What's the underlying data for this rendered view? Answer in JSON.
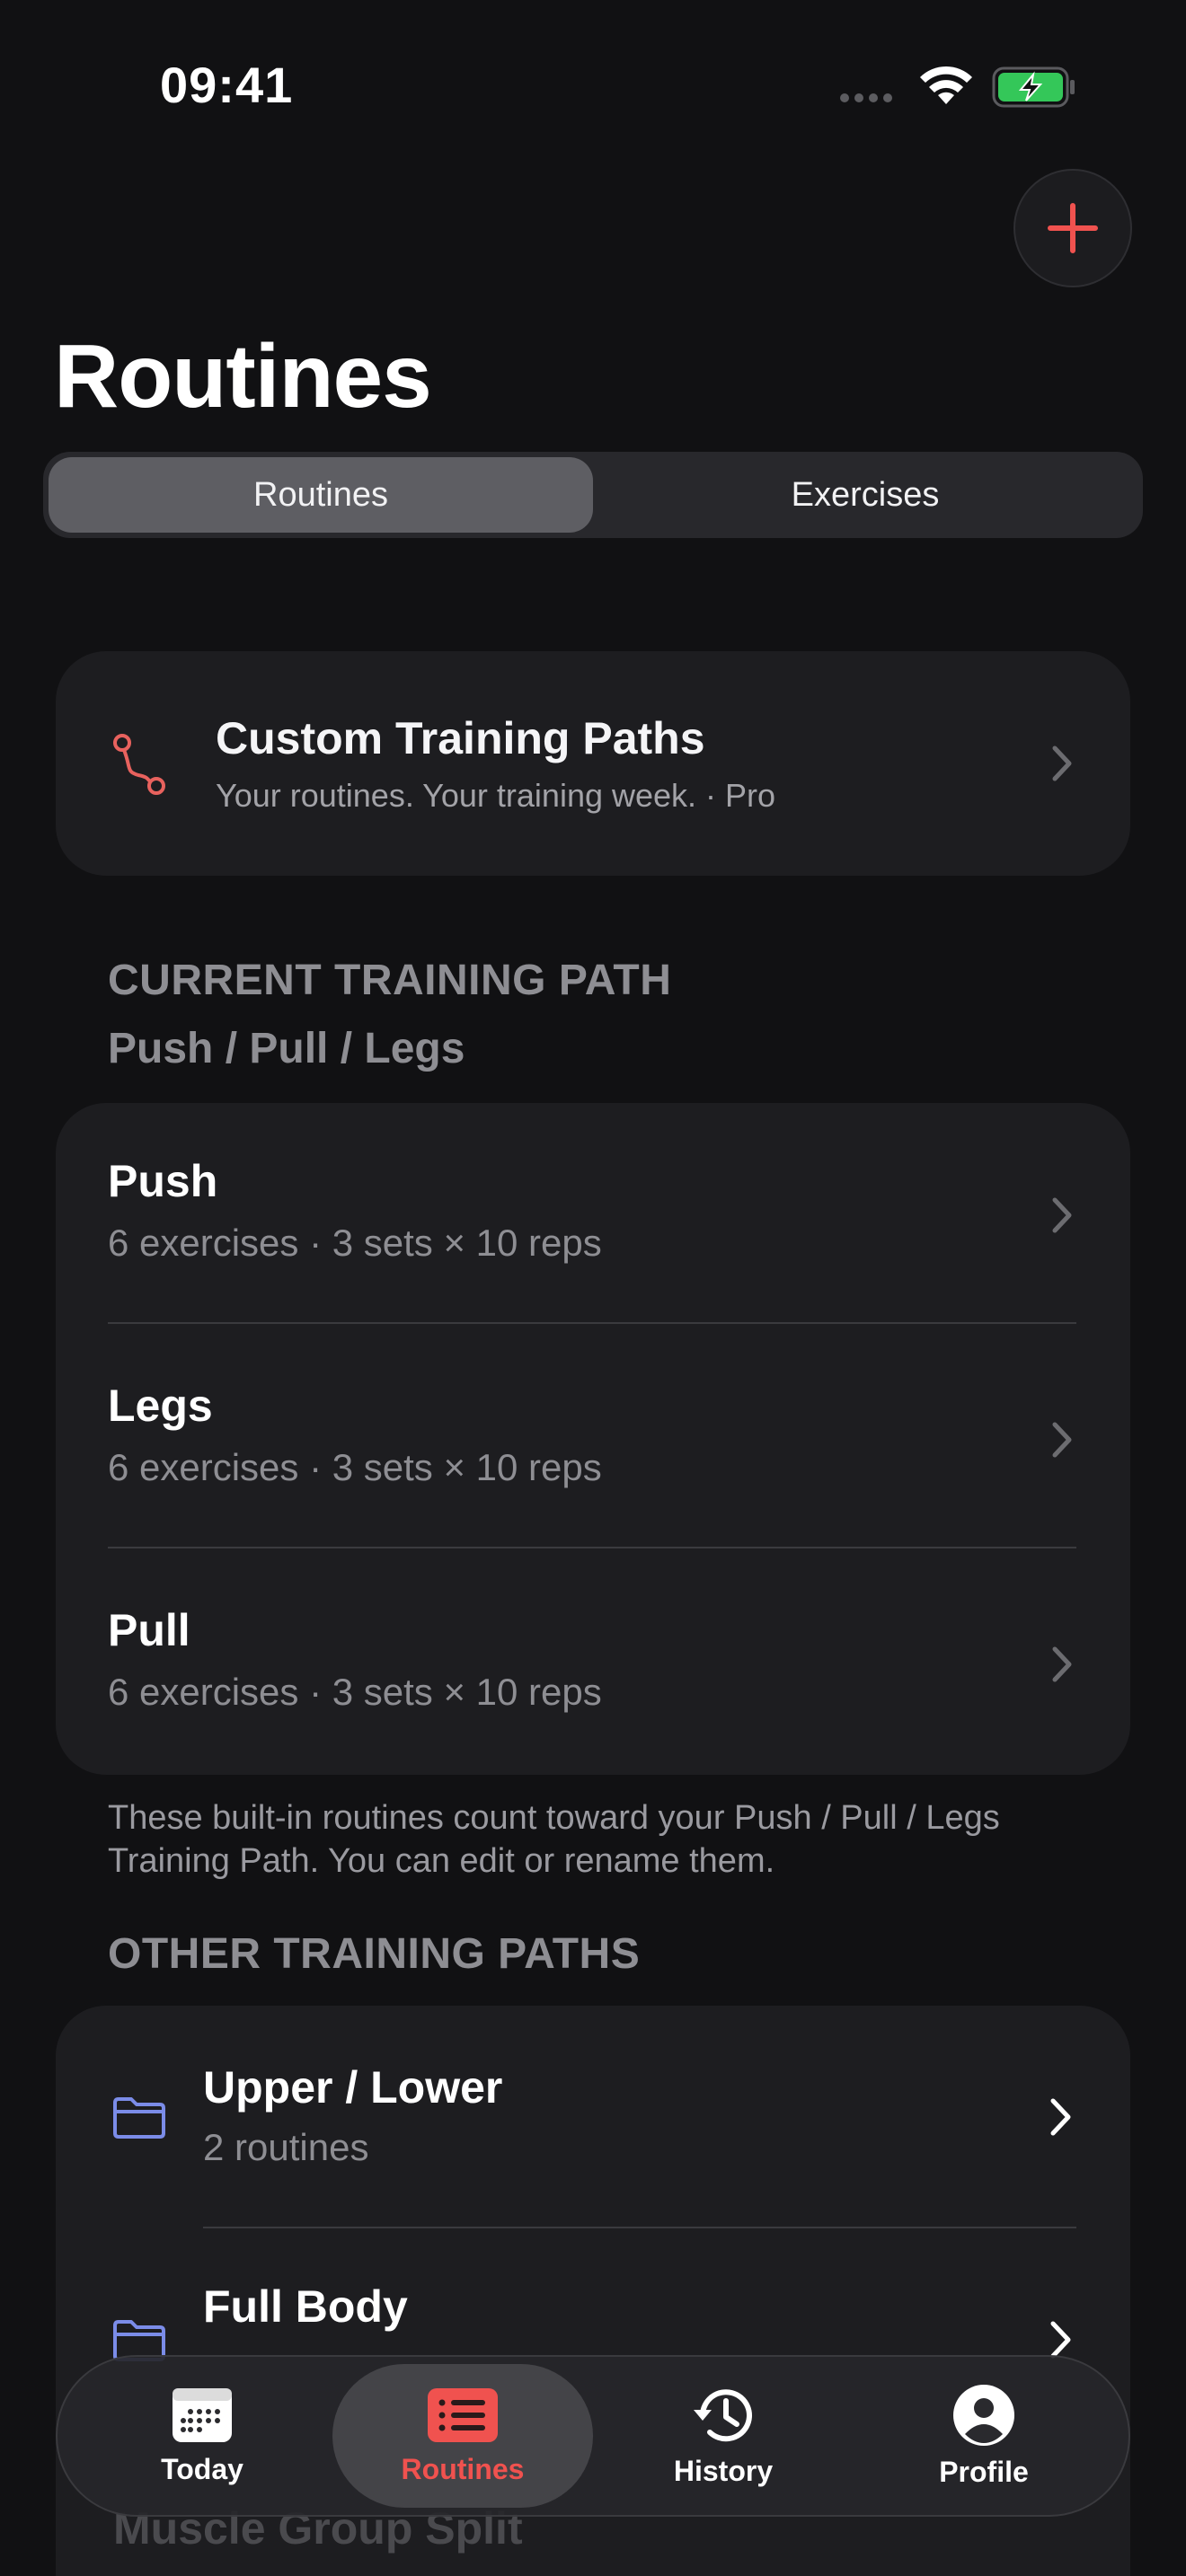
{
  "status_bar": {
    "time": "09:41"
  },
  "header": {
    "title": "Routines",
    "add_icon": "plus-icon"
  },
  "segmented": {
    "options": [
      "Routines",
      "Exercises"
    ],
    "selected": "Routines"
  },
  "custom_paths": {
    "title": "Custom Training Paths",
    "subtitle": "Your routines. Your training week. · Pro",
    "icon": "route-icon"
  },
  "current_path": {
    "header": "CURRENT TRAINING PATH",
    "name": "Push / Pull / Legs",
    "routines": [
      {
        "name": "Push",
        "meta": "6 exercises · 3 sets × 10 reps"
      },
      {
        "name": "Legs",
        "meta": "6 exercises · 3 sets × 10 reps"
      },
      {
        "name": "Pull",
        "meta": "6 exercises · 3 sets × 10 reps"
      }
    ],
    "footnote": "These built-in routines count toward your Push / Pull / Legs Training Path. You can edit or rename them."
  },
  "other_paths": {
    "header": "OTHER TRAINING PATHS",
    "items": [
      {
        "name": "Upper / Lower",
        "meta": "2 routines"
      },
      {
        "name": "Full Body",
        "meta": ""
      },
      {
        "name": "Muscle Group Split",
        "meta": ""
      }
    ]
  },
  "tabbar": {
    "tabs": [
      {
        "label": "Today",
        "icon": "calendar-icon"
      },
      {
        "label": "Routines",
        "icon": "list-icon"
      },
      {
        "label": "History",
        "icon": "history-icon"
      },
      {
        "label": "Profile",
        "icon": "profile-icon"
      }
    ],
    "active": "Routines"
  },
  "colors": {
    "accent": "#F0524F",
    "folder": "#7B8CE8",
    "route": "#E8625E",
    "battery": "#34C759"
  }
}
